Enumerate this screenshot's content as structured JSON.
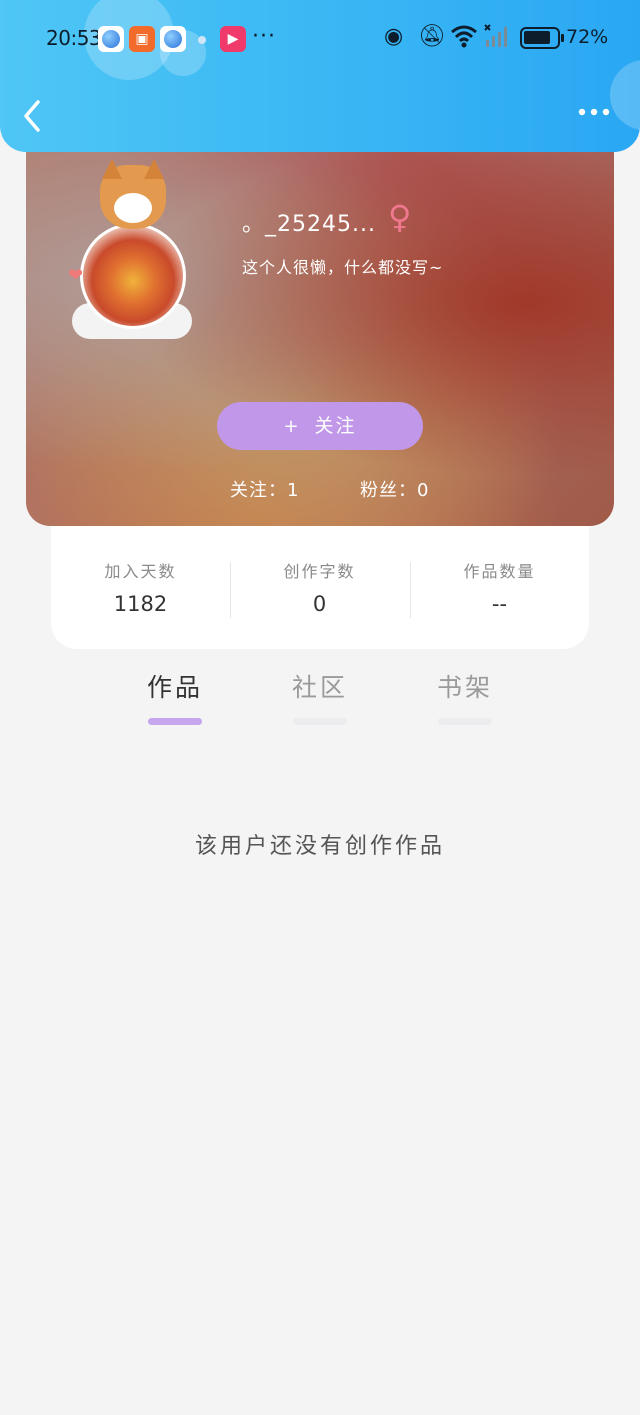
{
  "status_bar": {
    "time": "20:53",
    "battery": "72%",
    "icons": [
      "browser-icon",
      "gift-icon",
      "browser-icon",
      "dot",
      "video-icon",
      "more-dots",
      "eye-icon",
      "bell-off-icon",
      "wifi-icon",
      "signal-icon",
      "battery-icon"
    ]
  },
  "header": {
    "back_icon": "chevron-left-icon",
    "menu_icon": "more-horizontal-icon",
    "accent_color": "#3ab8f4"
  },
  "profile": {
    "username": "。_25245...",
    "gender_symbol": "♀",
    "bio": "这个人很懒，什么都没写~",
    "follow_button": "关注",
    "follow_plus": "+",
    "following": "关注：1",
    "fans": "粉丝：0"
  },
  "stats": [
    {
      "label": "加入天数",
      "value": "1182"
    },
    {
      "label": "创作字数",
      "value": "0"
    },
    {
      "label": "作品数量",
      "value": "--"
    }
  ],
  "tabs": [
    {
      "label": "作品",
      "active": true
    },
    {
      "label": "社区",
      "active": false
    },
    {
      "label": "书架",
      "active": false
    }
  ],
  "empty_message": "该用户还没有创作作品",
  "colors": {
    "follow_button": "#c197ea",
    "tab_indicator": "#c6a6ec",
    "gender": "#f0788e"
  }
}
